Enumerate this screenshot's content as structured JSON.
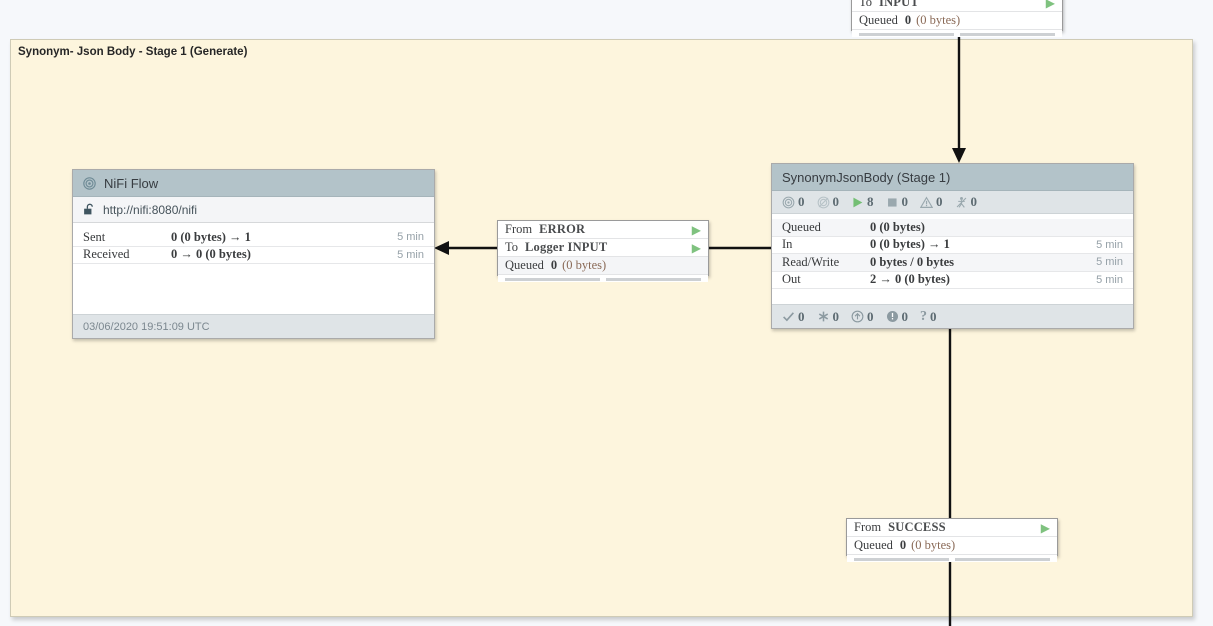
{
  "canvas": {
    "background_color": "#f6f8fb",
    "group_background_color": "#fdf5dd",
    "accent_green": "#7fc27f",
    "header_color": "#b3c3c9"
  },
  "process_group": {
    "title": "Synonym- Json Body - Stage 1 (Generate)"
  },
  "remote_group": {
    "name": "NiFi Flow",
    "icon": "remote-process-group-icon",
    "transmission_icon": "unlocked-padlock-icon",
    "url": "http://nifi:8080/nifi",
    "stats": [
      {
        "label": "Sent",
        "value": "0 (0 bytes) → 1",
        "time": "5 min"
      },
      {
        "label": "Received",
        "value": "0 → 0 (0 bytes)",
        "time": "5 min"
      }
    ],
    "last_refreshed": "03/06/2020 19:51:09 UTC"
  },
  "process_group_node": {
    "name": "SynonymJsonBody (Stage 1)",
    "status_counts": [
      {
        "icon": "transmitting-icon",
        "value": "0"
      },
      {
        "icon": "not-transmitting-icon",
        "value": "0"
      },
      {
        "icon": "running-icon",
        "value": "8"
      },
      {
        "icon": "stopped-icon",
        "value": "0"
      },
      {
        "icon": "invalid-icon",
        "value": "0"
      },
      {
        "icon": "disabled-icon",
        "value": "0"
      }
    ],
    "stats": [
      {
        "label": "Queued",
        "value": "0 (0 bytes)",
        "time": ""
      },
      {
        "label": "In",
        "value": "0 (0 bytes) → 1",
        "time": "5 min"
      },
      {
        "label": "Read/Write",
        "value": "0 bytes / 0 bytes",
        "time": "5 min"
      },
      {
        "label": "Out",
        "value": "2 → 0 (0 bytes)",
        "time": "5 min"
      }
    ],
    "bulletin_counts": [
      {
        "icon": "check-icon",
        "value": "0"
      },
      {
        "icon": "asterisk-icon",
        "value": "0"
      },
      {
        "icon": "up-arrow-circle-icon",
        "value": "0"
      },
      {
        "icon": "info-circle-icon",
        "value": "0"
      },
      {
        "icon": "question-icon",
        "value": "0"
      }
    ]
  },
  "connections": [
    {
      "id": "to-input",
      "rows": [
        {
          "key": "To",
          "value": "INPUT",
          "play": true
        }
      ],
      "queued_label": "Queued",
      "queued_value": "0",
      "queued_size": "(0 bytes)"
    },
    {
      "id": "error-to-logger",
      "rows": [
        {
          "key": "From",
          "value": "ERROR",
          "play": true
        },
        {
          "key": "To",
          "value": "Logger INPUT",
          "play": true
        }
      ],
      "queued_label": "Queued",
      "queued_value": "0",
      "queued_size": "(0 bytes)"
    },
    {
      "id": "from-success",
      "rows": [
        {
          "key": "From",
          "value": "SUCCESS",
          "play": true
        }
      ],
      "queued_label": "Queued",
      "queued_value": "0",
      "queued_size": "(0 bytes)"
    }
  ]
}
